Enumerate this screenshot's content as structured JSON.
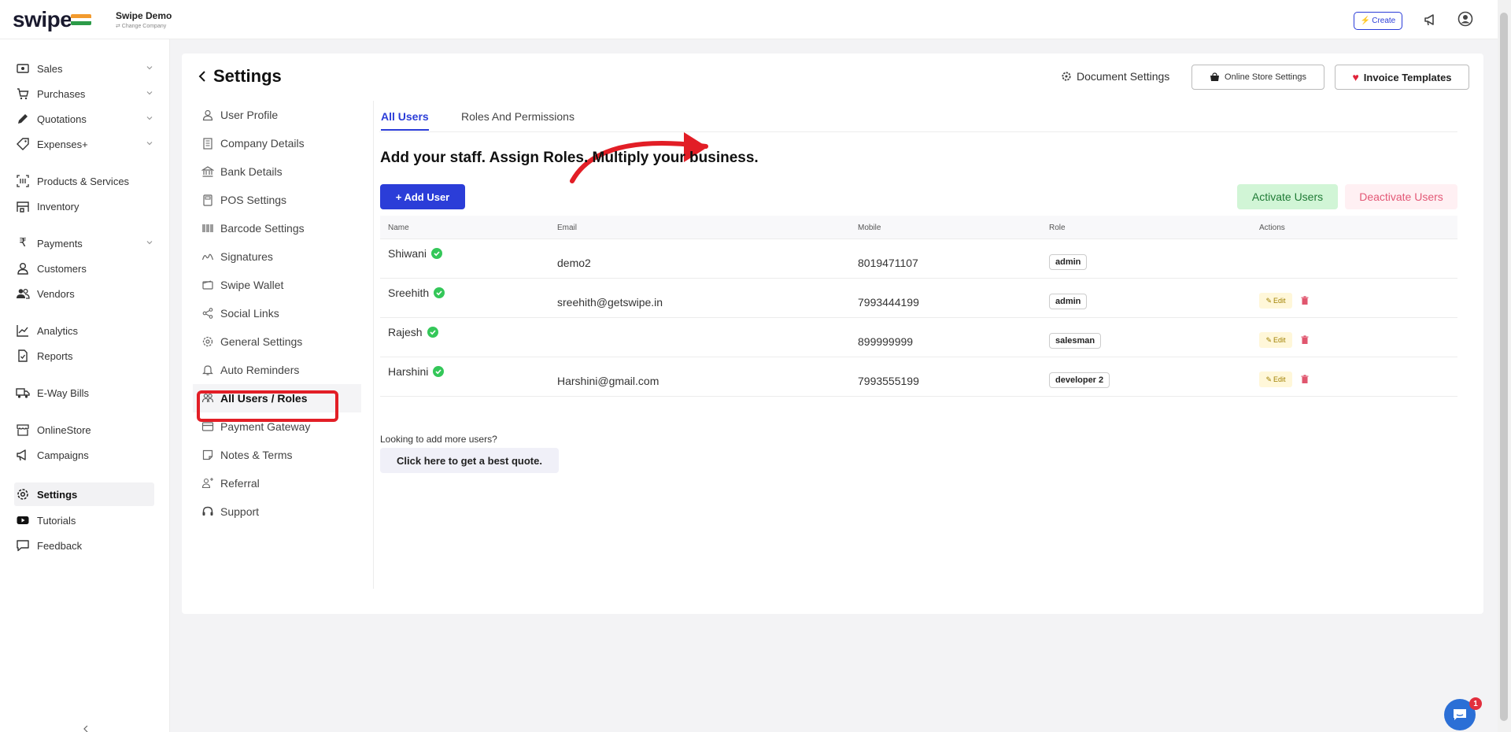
{
  "app": {
    "logo_text": "swipe",
    "company_name": "Swipe Demo",
    "change_company": "⇄ Change Company"
  },
  "topbar": {
    "create_label": "Create"
  },
  "sidebar": {
    "items": [
      {
        "label": "Sales",
        "icon": "cash-icon"
      },
      {
        "label": "Purchases",
        "icon": "cart-icon"
      },
      {
        "label": "Quotations",
        "icon": "pencil-icon"
      },
      {
        "label": "Expenses+",
        "icon": "tag-icon"
      },
      {
        "label": "Products & Services",
        "icon": "barcode-icon"
      },
      {
        "label": "Inventory",
        "icon": "warehouse-icon"
      },
      {
        "label": "Payments",
        "icon": "rupee-icon"
      },
      {
        "label": "Customers",
        "icon": "person-icon"
      },
      {
        "label": "Vendors",
        "icon": "people-icon"
      },
      {
        "label": "Analytics",
        "icon": "chart-icon"
      },
      {
        "label": "Reports",
        "icon": "report-icon"
      },
      {
        "label": "E-Way Bills",
        "icon": "truck-icon"
      },
      {
        "label": "OnlineStore",
        "icon": "store-icon"
      },
      {
        "label": "Campaigns",
        "icon": "megaphone-icon"
      },
      {
        "label": "Settings",
        "icon": "gear-icon"
      },
      {
        "label": "Tutorials",
        "icon": "youtube-icon"
      },
      {
        "label": "Feedback",
        "icon": "chat-icon"
      }
    ]
  },
  "header": {
    "title": "Settings",
    "document_settings": "Document Settings",
    "online_store_settings": "Online Store Settings",
    "invoice_templates": "Invoice Templates"
  },
  "settings_menu": {
    "items": [
      "User Profile",
      "Company Details",
      "Bank Details",
      "POS Settings",
      "Barcode Settings",
      "Signatures",
      "Swipe Wallet",
      "Social Links",
      "General Settings",
      "Auto Reminders",
      "All Users / Roles",
      "Payment Gateway",
      "Notes & Terms",
      "Referral",
      "Support"
    ]
  },
  "tabs": [
    "All Users",
    "Roles And Permissions"
  ],
  "main": {
    "headline": "Add your staff. Assign Roles. Multiply your business.",
    "add_user": "+ Add User",
    "activate_users": "Activate Users",
    "deactivate_users": "Deactivate Users",
    "more_users": "Looking to add more users?",
    "quote_button": "Click here to get a best quote."
  },
  "table": {
    "headers": [
      "Name",
      "Email",
      "Mobile",
      "Role",
      "Actions"
    ],
    "rows": [
      {
        "name": "Shiwani",
        "email": "demo2",
        "mobile": "8019471107",
        "role": "admin",
        "actions": false
      },
      {
        "name": "Sreehith",
        "email": "sreehith@getswipe.in",
        "mobile": "7993444199",
        "role": "admin",
        "actions": true
      },
      {
        "name": "Rajesh",
        "email": "",
        "mobile": "899999999",
        "role": "salesman",
        "actions": true
      },
      {
        "name": "Harshini",
        "email": "Harshini@gmail.com",
        "mobile": "7993555199",
        "role": "developer 2",
        "actions": true
      }
    ],
    "edit_label": "Edit"
  },
  "chat": {
    "badge_count": "1"
  },
  "colors": {
    "accent": "#2b3dd8",
    "highlight": "#e21e26",
    "success": "#34c759"
  }
}
